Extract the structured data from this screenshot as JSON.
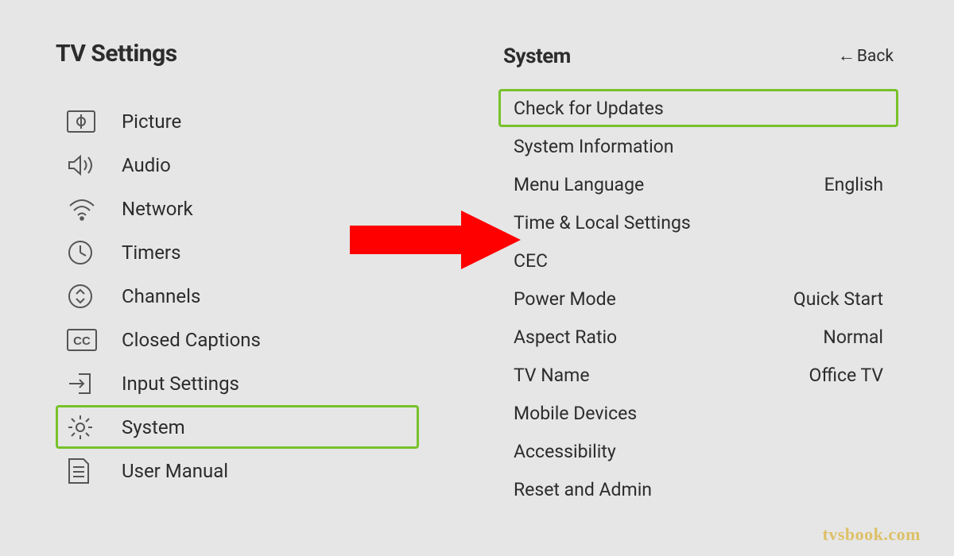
{
  "left": {
    "title": "TV Settings",
    "items": [
      {
        "label": "Picture",
        "icon": "picture-icon",
        "highlight": false
      },
      {
        "label": "Audio",
        "icon": "audio-icon",
        "highlight": false
      },
      {
        "label": "Network",
        "icon": "wifi-icon",
        "highlight": false
      },
      {
        "label": "Timers",
        "icon": "clock-icon",
        "highlight": false
      },
      {
        "label": "Channels",
        "icon": "channels-icon",
        "highlight": false
      },
      {
        "label": "Closed Captions",
        "icon": "cc-icon",
        "highlight": false
      },
      {
        "label": "Input Settings",
        "icon": "input-icon",
        "highlight": false
      },
      {
        "label": "System",
        "icon": "gear-icon",
        "highlight": true
      },
      {
        "label": "User Manual",
        "icon": "manual-icon",
        "highlight": false
      }
    ]
  },
  "right": {
    "title": "System",
    "back_label": "Back",
    "items": [
      {
        "label": "Check for Updates",
        "value": "",
        "highlight": true
      },
      {
        "label": "System Information",
        "value": "",
        "highlight": false
      },
      {
        "label": "Menu Language",
        "value": "English",
        "highlight": false
      },
      {
        "label": "Time & Local Settings",
        "value": "",
        "highlight": false
      },
      {
        "label": "CEC",
        "value": "",
        "highlight": false
      },
      {
        "label": "Power Mode",
        "value": "Quick Start",
        "highlight": false
      },
      {
        "label": "Aspect Ratio",
        "value": "Normal",
        "highlight": false
      },
      {
        "label": "TV Name",
        "value": "Office TV",
        "highlight": false
      },
      {
        "label": "Mobile Devices",
        "value": "",
        "highlight": false
      },
      {
        "label": "Accessibility",
        "value": "",
        "highlight": false
      },
      {
        "label": "Reset and Admin",
        "value": "",
        "highlight": false
      }
    ]
  },
  "annotation": {
    "arrow_color": "#ff0000",
    "highlight_color": "#77c22a"
  },
  "watermark": "tvsbook.com"
}
